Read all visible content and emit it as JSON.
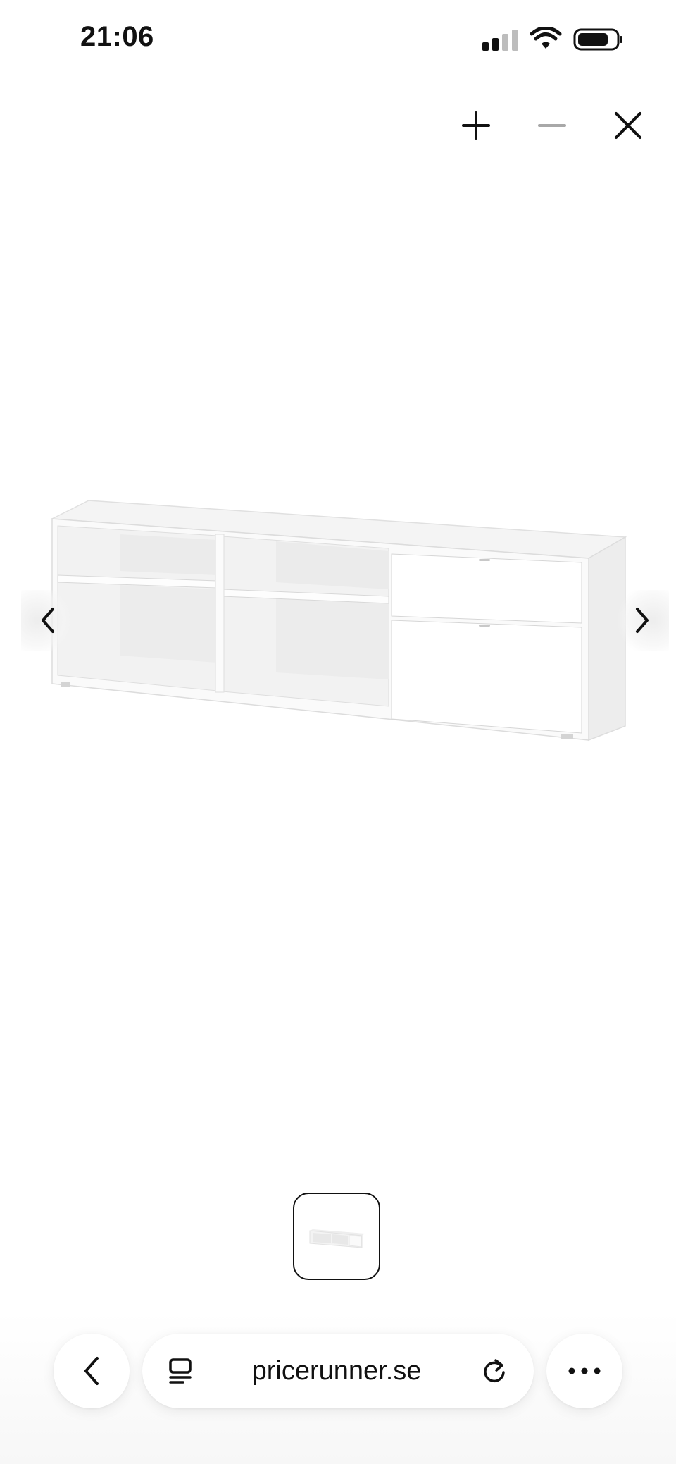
{
  "status_bar": {
    "time": "21:06",
    "icons": [
      "cellular-signal-icon",
      "wifi-icon",
      "battery-icon"
    ]
  },
  "viewer_toolbar": {
    "icons": [
      "zoom-in-icon",
      "zoom-out-icon",
      "close-icon"
    ]
  },
  "gallery": {
    "image": "white TV bench product image",
    "prev_icon": "chevron-left-icon",
    "next_icon": "chevron-right-icon",
    "thumbnails": 1
  },
  "browser_bar": {
    "url": "pricerunner.se",
    "icons": [
      "back-icon",
      "tabs-icon",
      "reload-icon",
      "more-icon"
    ]
  },
  "colors": {
    "text": "#111111",
    "dim_control": "#a8a8a8",
    "background": "#ffffff"
  }
}
